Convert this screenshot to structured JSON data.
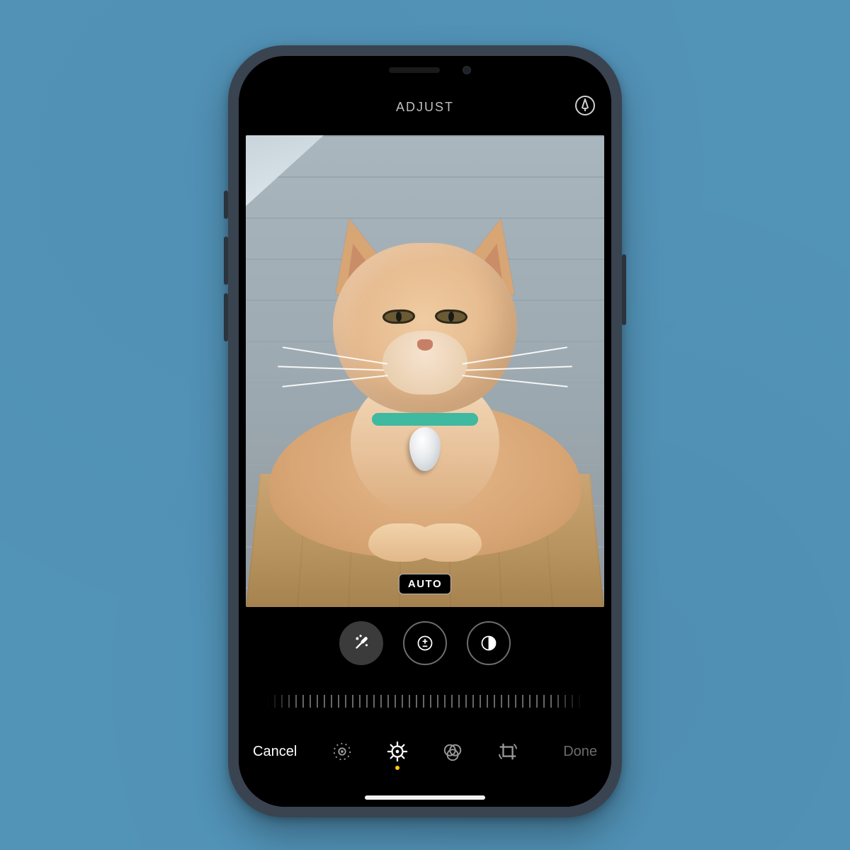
{
  "header": {
    "title": "ADJUST",
    "markup_icon": "markup-pen"
  },
  "photo": {
    "overlay_label": "AUTO"
  },
  "adjustments": {
    "tools": [
      {
        "name": "auto-magic-wand",
        "selected": true
      },
      {
        "name": "exposure",
        "selected": false
      },
      {
        "name": "brilliance",
        "selected": false
      }
    ]
  },
  "toolbar": {
    "cancel_label": "Cancel",
    "done_label": "Done",
    "done_enabled": false,
    "tabs": [
      {
        "name": "live-photo",
        "active": false
      },
      {
        "name": "adjust",
        "active": true
      },
      {
        "name": "filters",
        "active": false
      },
      {
        "name": "crop",
        "active": false
      }
    ]
  },
  "colors": {
    "accent_yellow": "#ffcc00",
    "inactive_grey": "#6c6c6c",
    "ring_grey": "#6d6d6d"
  }
}
